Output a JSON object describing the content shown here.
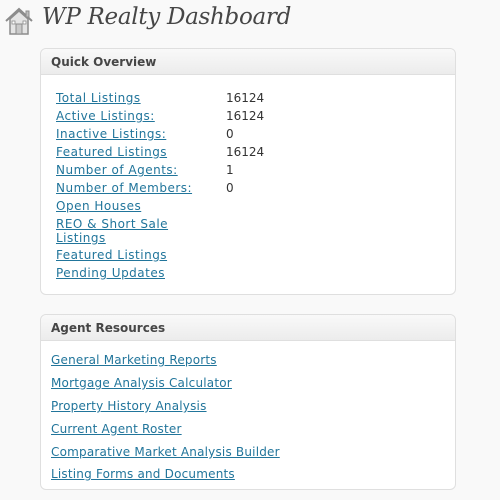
{
  "header": {
    "title": "WP Realty Dashboard",
    "icon": "house-icon"
  },
  "quick_overview": {
    "title": "Quick Overview",
    "stats": [
      {
        "label": "Total Listings",
        "value": "16124"
      },
      {
        "label": "Active Listings:",
        "value": "16124"
      },
      {
        "label": "Inactive Listings:",
        "value": "0"
      },
      {
        "label": "Featured Listings",
        "value": "16124"
      },
      {
        "label": "Number of Agents:",
        "value": "1"
      },
      {
        "label": "Number of Members:",
        "value": "0"
      }
    ],
    "links": [
      {
        "label": "Open Houses"
      },
      {
        "label": "REO & Short Sale Listings"
      },
      {
        "label": "Featured Listings"
      },
      {
        "label": "Pending Updates"
      }
    ]
  },
  "agent_resources": {
    "title": "Agent Resources",
    "links": [
      {
        "label": "General Marketing Reports"
      },
      {
        "label": "Mortgage Analysis Calculator"
      },
      {
        "label": "Property History Analysis"
      },
      {
        "label": "Current Agent Roster"
      },
      {
        "label": "Comparative Market Analysis Builder"
      },
      {
        "label": "Listing Forms and Documents"
      }
    ]
  },
  "colors": {
    "link": "#21759b",
    "text": "#333333",
    "title": "#464646",
    "background": "#f9f9f9"
  }
}
